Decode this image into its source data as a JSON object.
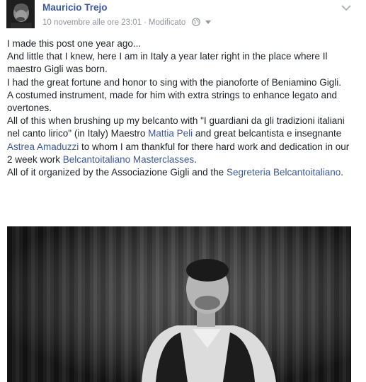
{
  "post": {
    "author": "Mauricio Trejo",
    "timestamp": "10 novembre alle ore 23:01",
    "separator": "·",
    "edited": "Modificato",
    "privacy_icon": "globe-icon",
    "menu_icon": "chevron-down-icon",
    "line1": "I made this post one year ago...",
    "line2": "And little that I knew, here I am in Italy a year later right in the place where Il maestro Gigli was born.",
    "line3": "I had the great fortune and honor to sing with the pianoforte of Beniamino Gigli.",
    "line4": "A costumed instrument, made for him with extra strings to enhance legato and overtones.",
    "line5_a": "All of this when brushing up my belcanto with \"I guardiani da gli tradizioni italiani nel canto lirico\" (in Italy) Maestro ",
    "line5_link1": "Mattia Peli",
    "line5_b": " and great belcantista e insegnante ",
    "line5_link2": "Astrea Amaduzzi",
    "line5_c": " to whom I am thankful for there hard work and dedication in our 2 week work ",
    "line5_link3": "Belcantoitaliano Masterclasses",
    "line5_d": ".",
    "line6_a": "All of it organized by the Associazione Gigli and the ",
    "line6_link": "Segreteria Belcantoitaliano",
    "line6_b": "."
  },
  "colors": {
    "link": "#3b5998",
    "text": "#1d2129",
    "meta": "#90949c"
  }
}
